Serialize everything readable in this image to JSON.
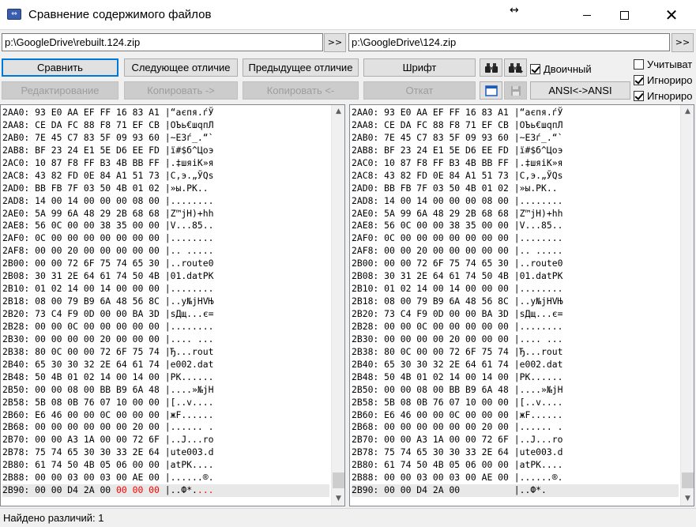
{
  "window": {
    "title": "Сравнение содержимого файлов",
    "resize_glyph": "↔",
    "close_glyph": "✕"
  },
  "paths": {
    "left": "p:\\GoogleDrive\\rebuilt.124.zip",
    "right": "p:\\GoogleDrive\\124.zip",
    "browse_label": ">>"
  },
  "toolbar": {
    "compare": "Сравнить",
    "next_diff": "Следующее отличие",
    "prev_diff": "Предыдущее отличие",
    "font": "Шрифт",
    "binary_label": "Двоичный",
    "binary_checked": true,
    "edit": "Редактирование",
    "copy_right": "Копировать ->",
    "copy_left": "Копировать <-",
    "undo": "Откат",
    "ansi": "ANSI<->ANSI",
    "opt1_label": "Учитыват",
    "opt1_checked": false,
    "opt2_label": "Игнориро",
    "opt2_checked": true,
    "opt3_label": "Игнориро",
    "opt3_checked": true
  },
  "left_pane": {
    "lines": [
      {
        "addr": "2AA0:",
        "bytes": "93 E0 AA EF FF 16 83 A1",
        "ascii": "“аєпя.ѓЎ"
      },
      {
        "addr": "2AA8:",
        "bytes": "CE DA FC 88 F8 71 EF CB",
        "ascii": "ОЪь€шqпЛ"
      },
      {
        "addr": "2AB0:",
        "bytes": "7E 45 C7 83 5F 09 93 60",
        "ascii": "~EЗѓ_.“`"
      },
      {
        "addr": "2AB8:",
        "bytes": "BF 23 24 E1 5E D6 EE FD",
        "ascii": "ї#$б^Цоэ"
      },
      {
        "addr": "2AC0:",
        "bytes": "10 87 F8 FF B3 4B BB FF",
        "ascii": ".‡шяіK»я"
      },
      {
        "addr": "2AC8:",
        "bytes": "43 82 FD 0E 84 A1 51 73",
        "ascii": "C‚э.„ЎQs"
      },
      {
        "addr": "2AD0:",
        "bytes": "BB FB 7F 03 50 4B 01 02",
        "ascii": "»ы.PK.."
      },
      {
        "addr": "2AD8:",
        "bytes": "14 00 14 00 00 00 08 00",
        "ascii": "........"
      },
      {
        "addr": "2AE0:",
        "bytes": "5A 99 6A 48 29 2B 68 68",
        "ascii": "Z™jH)+hh"
      },
      {
        "addr": "2AE8:",
        "bytes": "56 0C 00 00 38 35 00 00",
        "ascii": "V...85.."
      },
      {
        "addr": "2AF0:",
        "bytes": "0C 00 00 00 00 00 00 00",
        "ascii": "........"
      },
      {
        "addr": "2AF8:",
        "bytes": "00 00 20 00 00 00 00 00",
        "ascii": ".. ....."
      },
      {
        "addr": "2B00:",
        "bytes": "00 00 72 6F 75 74 65 30",
        "ascii": "..route0"
      },
      {
        "addr": "2B08:",
        "bytes": "30 31 2E 64 61 74 50 4B",
        "ascii": "01.datPK"
      },
      {
        "addr": "2B10:",
        "bytes": "01 02 14 00 14 00 00 00",
        "ascii": "........"
      },
      {
        "addr": "2B18:",
        "bytes": "08 00 79 B9 6A 48 56 8C",
        "ascii": "..y№jHVЊ"
      },
      {
        "addr": "2B20:",
        "bytes": "73 C4 F9 0D 00 00 BA 3D",
        "ascii": "sДщ...є="
      },
      {
        "addr": "2B28:",
        "bytes": "00 00 0C 00 00 00 00 00",
        "ascii": "........"
      },
      {
        "addr": "2B30:",
        "bytes": "00 00 00 00 20 00 00 00",
        "ascii": ".... ..."
      },
      {
        "addr": "2B38:",
        "bytes": "80 0C 00 00 72 6F 75 74",
        "ascii": "Ђ...rout"
      },
      {
        "addr": "2B40:",
        "bytes": "65 30 30 32 2E 64 61 74",
        "ascii": "e002.dat"
      },
      {
        "addr": "2B48:",
        "bytes": "50 4B 01 02 14 00 14 00",
        "ascii": "PK......"
      },
      {
        "addr": "2B50:",
        "bytes": "00 00 08 00 BB B9 6A 48",
        "ascii": "....»№jH"
      },
      {
        "addr": "2B58:",
        "bytes": "5B 08 0B 76 07 10 00 00",
        "ascii": "[..v...."
      },
      {
        "addr": "2B60:",
        "bytes": "E6 46 00 00 0C 00 00 00",
        "ascii": "жF......"
      },
      {
        "addr": "2B68:",
        "bytes": "00 00 00 00 00 00 20 00",
        "ascii": "...... ."
      },
      {
        "addr": "2B70:",
        "bytes": "00 00 A3 1A 00 00 72 6F",
        "ascii": "..Ј...ro"
      },
      {
        "addr": "2B78:",
        "bytes": "75 74 65 30 30 33 2E 64",
        "ascii": "ute003.d"
      },
      {
        "addr": "2B80:",
        "bytes": "61 74 50 4B 05 06 00 00",
        "ascii": "atPK...."
      },
      {
        "addr": "2B88:",
        "bytes": "00 00 03 00 03 00 AE 00",
        "ascii": "......®."
      }
    ],
    "last_line": {
      "addr": "2B90:",
      "bytes_same": "00 00 D4 2A 00",
      "bytes_diff": "00 00 00",
      "ascii_same": "..Ф*.",
      "ascii_diff": "..."
    }
  },
  "right_pane": {
    "lines": [
      {
        "addr": "2AA0:",
        "bytes": "93 E0 AA EF FF 16 83 A1",
        "ascii": "“аєпя.ѓЎ"
      },
      {
        "addr": "2AA8:",
        "bytes": "CE DA FC 88 F8 71 EF CB",
        "ascii": "ОЪь€шqпЛ"
      },
      {
        "addr": "2AB0:",
        "bytes": "7E 45 C7 83 5F 09 93 60",
        "ascii": "~EЗѓ_.“`"
      },
      {
        "addr": "2AB8:",
        "bytes": "BF 23 24 E1 5E D6 EE FD",
        "ascii": "ї#$б^Цоэ"
      },
      {
        "addr": "2AC0:",
        "bytes": "10 87 F8 FF B3 4B BB FF",
        "ascii": ".‡шяіK»я"
      },
      {
        "addr": "2AC8:",
        "bytes": "43 82 FD 0E 84 A1 51 73",
        "ascii": "C‚э.„ЎQs"
      },
      {
        "addr": "2AD0:",
        "bytes": "BB FB 7F 03 50 4B 01 02",
        "ascii": "»ы.PK.."
      },
      {
        "addr": "2AD8:",
        "bytes": "14 00 14 00 00 00 08 00",
        "ascii": "........"
      },
      {
        "addr": "2AE0:",
        "bytes": "5A 99 6A 48 29 2B 68 68",
        "ascii": "Z™jH)+hh"
      },
      {
        "addr": "2AE8:",
        "bytes": "56 0C 00 00 38 35 00 00",
        "ascii": "V...85.."
      },
      {
        "addr": "2AF0:",
        "bytes": "0C 00 00 00 00 00 00 00",
        "ascii": "........"
      },
      {
        "addr": "2AF8:",
        "bytes": "00 00 20 00 00 00 00 00",
        "ascii": ".. ....."
      },
      {
        "addr": "2B00:",
        "bytes": "00 00 72 6F 75 74 65 30",
        "ascii": "..route0"
      },
      {
        "addr": "2B08:",
        "bytes": "30 31 2E 64 61 74 50 4B",
        "ascii": "01.datPK"
      },
      {
        "addr": "2B10:",
        "bytes": "01 02 14 00 14 00 00 00",
        "ascii": "........"
      },
      {
        "addr": "2B18:",
        "bytes": "08 00 79 B9 6A 48 56 8C",
        "ascii": "..y№jHVЊ"
      },
      {
        "addr": "2B20:",
        "bytes": "73 C4 F9 0D 00 00 BA 3D",
        "ascii": "sДщ...є="
      },
      {
        "addr": "2B28:",
        "bytes": "00 00 0C 00 00 00 00 00",
        "ascii": "........"
      },
      {
        "addr": "2B30:",
        "bytes": "00 00 00 00 20 00 00 00",
        "ascii": ".... ..."
      },
      {
        "addr": "2B38:",
        "bytes": "80 0C 00 00 72 6F 75 74",
        "ascii": "Ђ...rout"
      },
      {
        "addr": "2B40:",
        "bytes": "65 30 30 32 2E 64 61 74",
        "ascii": "e002.dat"
      },
      {
        "addr": "2B48:",
        "bytes": "50 4B 01 02 14 00 14 00",
        "ascii": "PK......"
      },
      {
        "addr": "2B50:",
        "bytes": "00 00 08 00 BB B9 6A 48",
        "ascii": "....»№jH"
      },
      {
        "addr": "2B58:",
        "bytes": "5B 08 0B 76 07 10 00 00",
        "ascii": "[..v...."
      },
      {
        "addr": "2B60:",
        "bytes": "E6 46 00 00 0C 00 00 00",
        "ascii": "жF......"
      },
      {
        "addr": "2B68:",
        "bytes": "00 00 00 00 00 00 20 00",
        "ascii": "...... ."
      },
      {
        "addr": "2B70:",
        "bytes": "00 00 A3 1A 00 00 72 6F",
        "ascii": "..Ј...ro"
      },
      {
        "addr": "2B78:",
        "bytes": "75 74 65 30 30 33 2E 64",
        "ascii": "ute003.d"
      },
      {
        "addr": "2B80:",
        "bytes": "61 74 50 4B 05 06 00 00",
        "ascii": "atPK...."
      },
      {
        "addr": "2B88:",
        "bytes": "00 00 03 00 03 00 AE 00",
        "ascii": "......®."
      }
    ],
    "last_line": {
      "addr": "2B90:",
      "bytes": "00 00 D4 2A 00",
      "ascii": "..Ф*."
    }
  },
  "status": {
    "text": "Найдено различий: 1"
  },
  "colors": {
    "diff": "#ff0000",
    "accent": "#0078d7"
  }
}
